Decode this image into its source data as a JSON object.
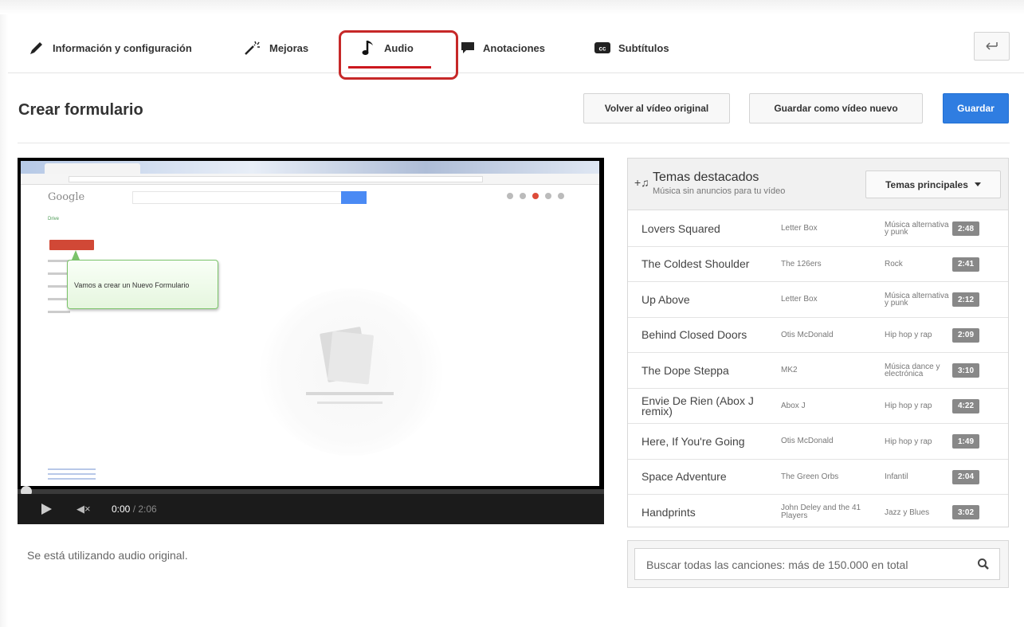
{
  "tabs": [
    {
      "label": "Información y configuración",
      "icon": "pencil-icon"
    },
    {
      "label": "Mejoras",
      "icon": "magic-wand-icon"
    },
    {
      "label": "Audio",
      "icon": "music-note-icon",
      "active": true
    },
    {
      "label": "Anotaciones",
      "icon": "speech-bubble-icon"
    },
    {
      "label": "Subtítulos",
      "icon": "cc-icon"
    }
  ],
  "back_button_icon": "back-arrow-icon",
  "header": {
    "title": "Crear formulario",
    "revert_label": "Volver al vídeo original",
    "save_as_label": "Guardar como vídeo nuevo",
    "save_label": "Guardar"
  },
  "video": {
    "tooltip_text": "Vamos a crear un Nuevo Formulario",
    "logo_text": "Google",
    "drive_label": "Drive",
    "current_time": "0:00",
    "duration": "/ 2:06",
    "progress": 0
  },
  "audio_status": "Se está utilizando audio original.",
  "music": {
    "title": "Temas destacados",
    "subtitle": "Música sin anuncios para tu vídeo",
    "genre_selected": "Temas principales",
    "tracks": [
      {
        "title": "Lovers Squared",
        "artist": "Letter Box",
        "genre": "Música alternativa y punk",
        "duration": "2:48"
      },
      {
        "title": "The Coldest Shoulder",
        "artist": "The 126ers",
        "genre": "Rock",
        "duration": "2:41"
      },
      {
        "title": "Up Above",
        "artist": "Letter Box",
        "genre": "Música alternativa y punk",
        "duration": "2:12"
      },
      {
        "title": "Behind Closed Doors",
        "artist": "Otis McDonald",
        "genre": "Hip hop y rap",
        "duration": "2:09"
      },
      {
        "title": "The Dope Steppa",
        "artist": "MK2",
        "genre": "Música dance y electrónica",
        "duration": "3:10"
      },
      {
        "title": "Envie De Rien (Abox J remix)",
        "artist": "Abox J",
        "genre": "Hip hop y rap",
        "duration": "4:22"
      },
      {
        "title": "Here, If You're Going",
        "artist": "Otis McDonald",
        "genre": "Hip hop y rap",
        "duration": "1:49"
      },
      {
        "title": "Space Adventure",
        "artist": "The Green Orbs",
        "genre": "Infantil",
        "duration": "2:04"
      },
      {
        "title": "Handprints",
        "artist": "John Deley and the 41 Players",
        "genre": "Jazz y Blues",
        "duration": "3:02"
      }
    ],
    "search_placeholder": "Buscar todas las canciones: más de 150.000 en total"
  },
  "colors": {
    "accent": "#2f7de1",
    "active_underline": "#cc181e",
    "highlight": "#c62828"
  }
}
